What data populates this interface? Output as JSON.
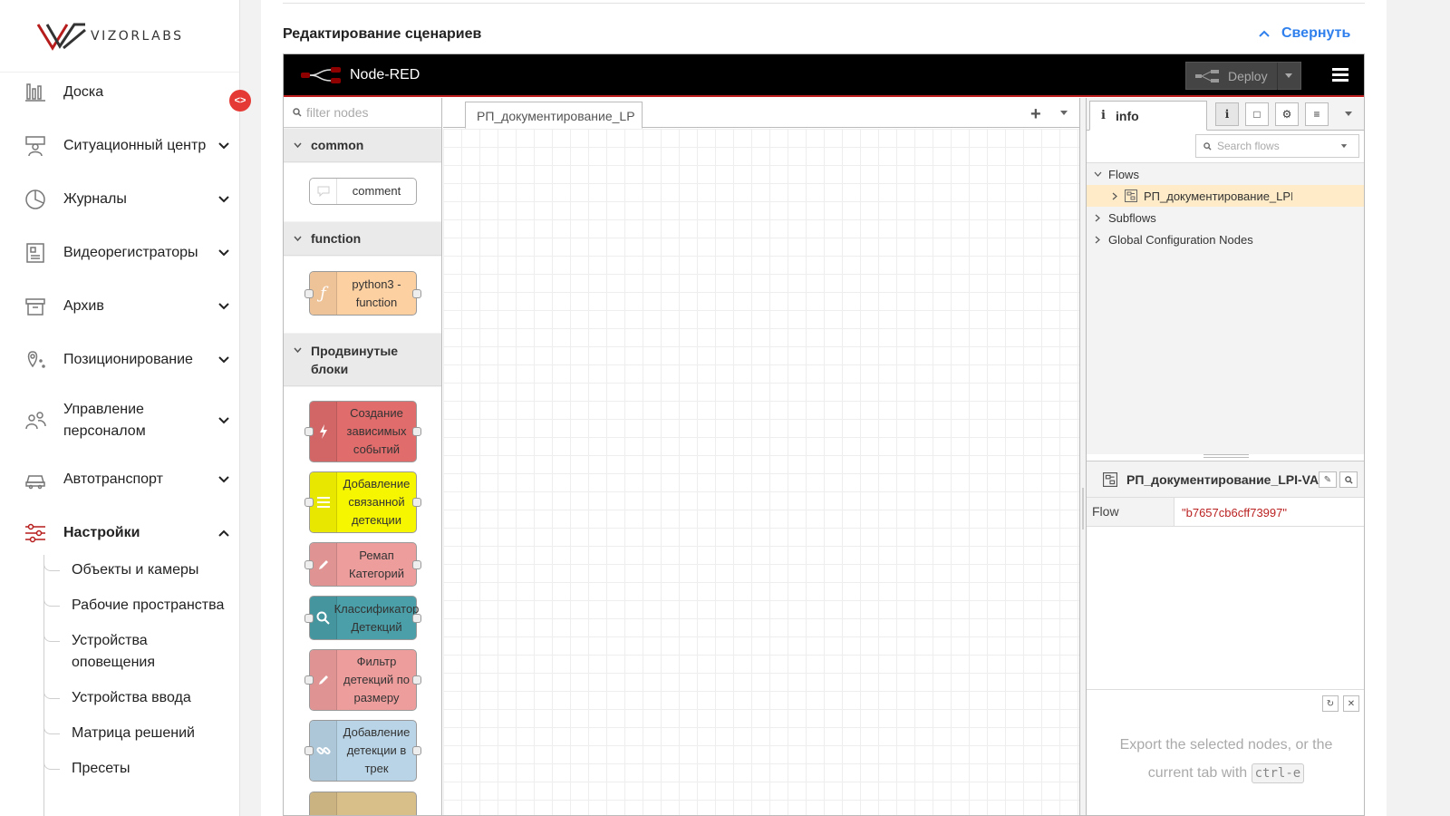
{
  "sidebar": {
    "logo_text": "VIZORLABS",
    "brand_color": "#b71c1c",
    "items": [
      {
        "label": "Доска",
        "icon": "bar-chart-icon",
        "expandable": false
      },
      {
        "label": "Ситуационный центр",
        "icon": "operator-icon",
        "expandable": true
      },
      {
        "label": "Журналы",
        "icon": "pie-chart-icon",
        "expandable": true
      },
      {
        "label": "Видеорегистраторы",
        "icon": "recorder-icon",
        "expandable": true
      },
      {
        "label": "Архив",
        "icon": "archive-icon",
        "expandable": true
      },
      {
        "label": "Позиционирование",
        "icon": "location-pin-icon",
        "expandable": true
      },
      {
        "label": "Управление персоналом",
        "icon": "people-icon",
        "expandable": true
      },
      {
        "label": "Автотранспорт",
        "icon": "car-icon",
        "expandable": true
      },
      {
        "label": "Настройки",
        "icon": "sliders-icon",
        "expandable": true,
        "active": true
      }
    ],
    "subitems": [
      "Объекты и камеры",
      "Рабочие пространства",
      "Устройства оповещения",
      "Устройства ввода",
      "Матрица решений",
      "Пресеты"
    ]
  },
  "main": {
    "section_title": "Редактирование сценариев",
    "collapse_label": "Свернуть",
    "accent": "#2f80ed"
  },
  "nodered": {
    "title": "Node-RED",
    "deploy_label": "Deploy",
    "filter_placeholder": "filter nodes",
    "categories": [
      {
        "label": "common",
        "nodes": [
          {
            "label": "comment",
            "color": "#ffffff",
            "icon": "comment-icon"
          }
        ]
      },
      {
        "label": "function",
        "nodes": [
          {
            "label": "python3 - function",
            "color": "#fdd0a2",
            "icon": "function-icon"
          }
        ]
      },
      {
        "label": "Продвинутые блоки",
        "nodes": [
          {
            "label": "Создание зависимых событий",
            "color": "#e06c6c",
            "icon": "lightning-icon"
          },
          {
            "label": "Добавление связанной детекции",
            "color": "#f6f600",
            "icon": "list-icon"
          },
          {
            "label": "Ремап Категорий",
            "color": "#ee9d9d",
            "icon": "pencil-icon"
          },
          {
            "label": "Классификатор Детекций",
            "color": "#4a9fa8",
            "icon": "search-icon"
          },
          {
            "label": "Фильтр детекций по размеру",
            "color": "#ee9d9d",
            "icon": "pencil-icon"
          },
          {
            "label": "Добавление детекции в трек",
            "color": "#b8d4e6",
            "icon": "link-icon"
          }
        ]
      }
    ],
    "workspace_tab": "РП_документирование_LP",
    "info_tab": "info",
    "search_flows_placeholder": "Search flows",
    "tree": {
      "flows": "Flows",
      "flow_item": "РП_документирование_LPI",
      "subflows": "Subflows",
      "global_config": "Global Configuration Nodes"
    },
    "props": {
      "title": "РП_документирование_LPI-VAI",
      "key": "Flow",
      "value": "\"b7657cb6cff73997\""
    },
    "export": {
      "text_before": "Export the selected nodes, or the current tab with",
      "shortcut": "ctrl-e"
    }
  }
}
